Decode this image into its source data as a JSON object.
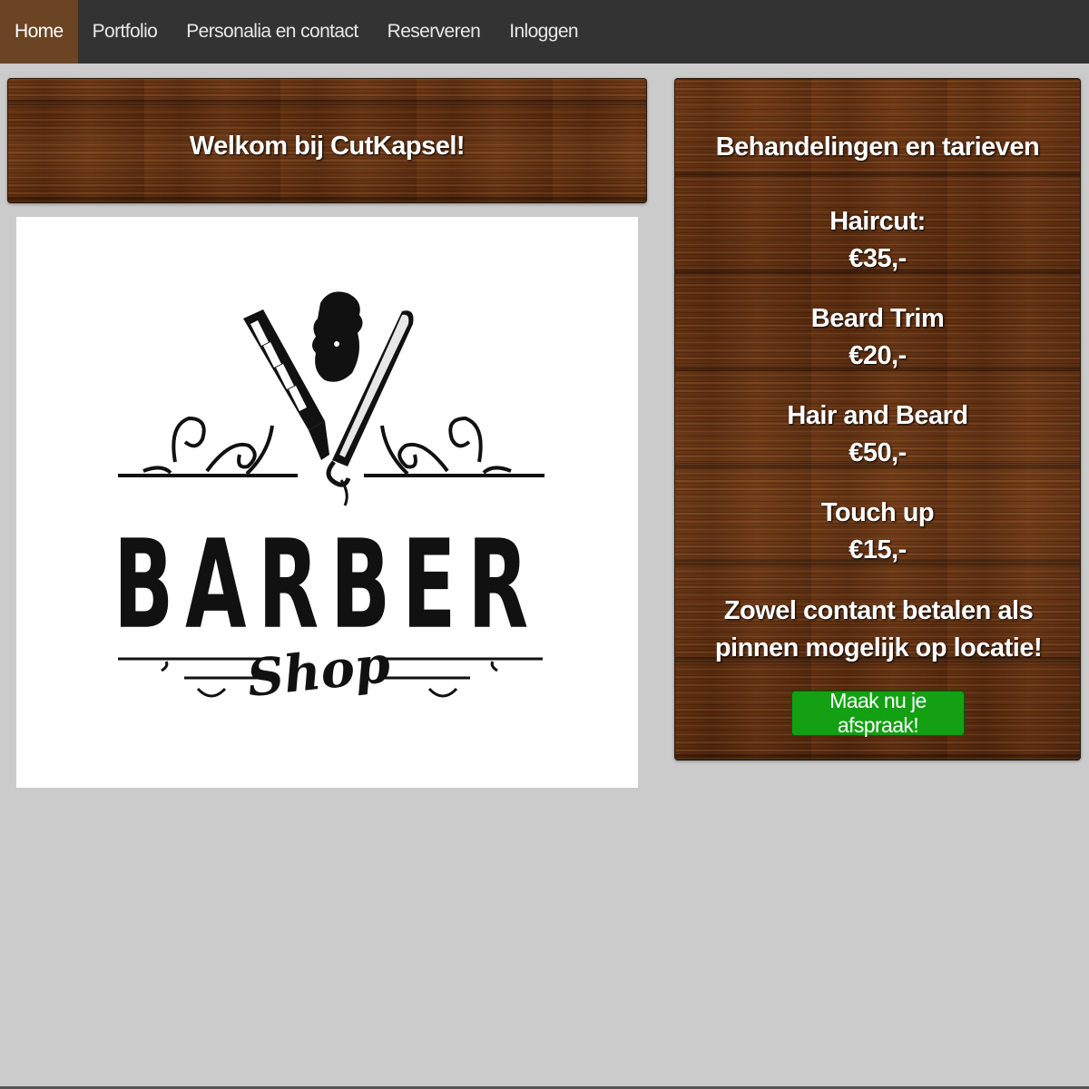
{
  "nav": {
    "items": [
      {
        "label": "Home",
        "active": true
      },
      {
        "label": "Portfolio",
        "active": false
      },
      {
        "label": "Personalia en contact",
        "active": false
      },
      {
        "label": "Reserveren",
        "active": false
      },
      {
        "label": "Inloggen",
        "active": false
      }
    ]
  },
  "welcome": {
    "title": "Welkom bij CutKapsel!"
  },
  "logo": {
    "word": "BARBER",
    "script": "Shop"
  },
  "prices": {
    "title": "Behandelingen en tarieven",
    "items": [
      {
        "name": "Haircut:",
        "price": "€35,-"
      },
      {
        "name": "Beard Trim",
        "price": "€20,-"
      },
      {
        "name": "Hair and Beard",
        "price": "€50,-"
      },
      {
        "name": "Touch up",
        "price": "€15,-"
      }
    ],
    "payment_note": "Zowel contant betalen als pinnen mogelijk op locatie!",
    "button_label": "Maak nu je afspraak!"
  },
  "colors": {
    "nav_bg": "#333333",
    "nav_active": "#6a4423",
    "page_bg": "#cbcbcb",
    "button_green": "#13a013",
    "wood": "#5a2e12"
  }
}
